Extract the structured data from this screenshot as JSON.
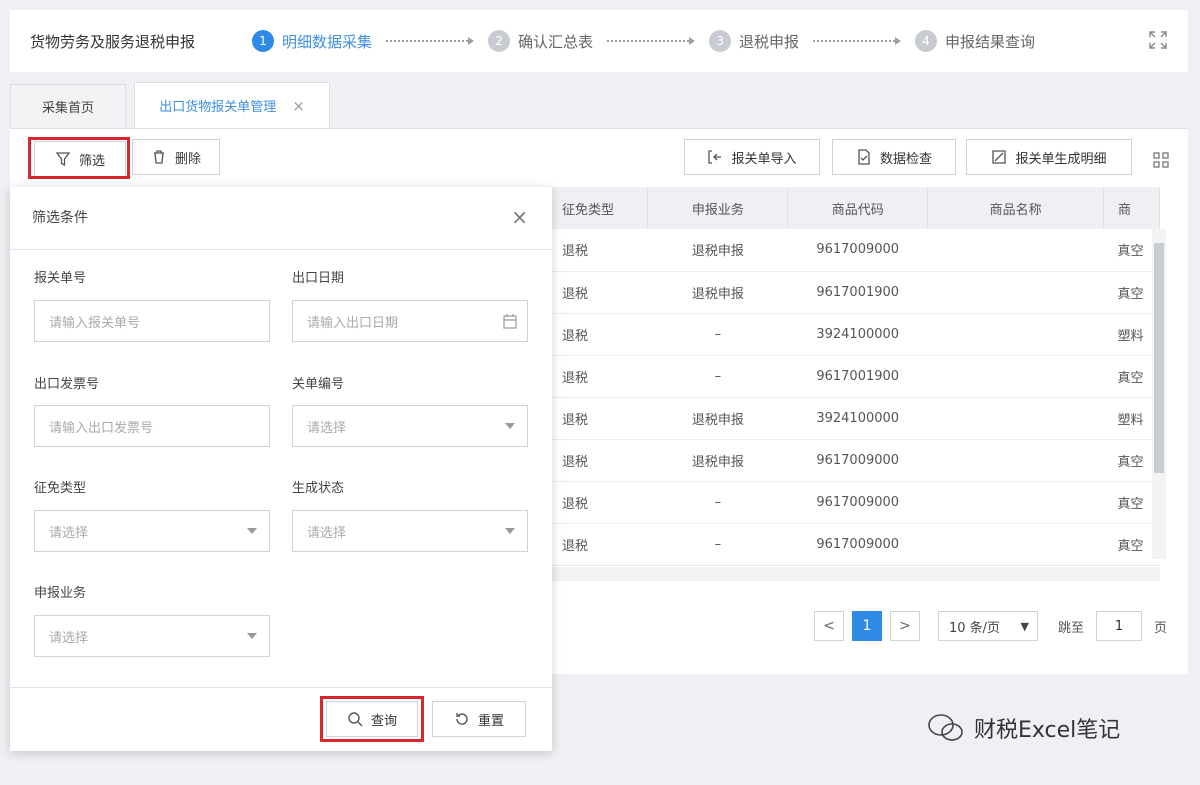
{
  "header": {
    "app_title": "货物劳务及服务退税申报",
    "steps": [
      {
        "num": "1",
        "label": "明细数据采集"
      },
      {
        "num": "2",
        "label": "确认汇总表"
      },
      {
        "num": "3",
        "label": "退税申报"
      },
      {
        "num": "4",
        "label": "申报结果查询"
      }
    ]
  },
  "tabs": [
    {
      "label": "采集首页"
    },
    {
      "label": "出口货物报关单管理",
      "close": "×"
    }
  ],
  "toolbar": {
    "filter_label": "筛选",
    "delete_label": "删除",
    "import_label": "报关单导入",
    "check_label": "数据检查",
    "generate_label": "报关单生成明细"
  },
  "table": {
    "headers": [
      "征免类型",
      "申报业务",
      "商品代码",
      "商品名称",
      "商"
    ],
    "rows": [
      [
        "退税",
        "退税申报",
        "9617009000",
        "",
        "真空"
      ],
      [
        "退税",
        "退税申报",
        "9617001900",
        "",
        "真空"
      ],
      [
        "退税",
        "–",
        "3924100000",
        "",
        "塑料"
      ],
      [
        "退税",
        "–",
        "9617001900",
        "",
        "真空"
      ],
      [
        "退税",
        "退税申报",
        "3924100000",
        "",
        "塑料"
      ],
      [
        "退税",
        "退税申报",
        "9617009000",
        "",
        "真空"
      ],
      [
        "退税",
        "–",
        "9617009000",
        "",
        "真空"
      ],
      [
        "退税",
        "–",
        "9617009000",
        "",
        "真空"
      ]
    ]
  },
  "pager": {
    "prev": "<",
    "current": "1",
    "next": ">",
    "page_size": "10 条/页",
    "jump_prefix": "跳至",
    "jump_value": "1",
    "jump_suffix": "页"
  },
  "filter": {
    "title": "筛选条件",
    "close": "×",
    "fields": {
      "declaration_no": {
        "label": "报关单号",
        "placeholder": "请输入报关单号"
      },
      "export_date": {
        "label": "出口日期",
        "placeholder": "请输入出口日期"
      },
      "invoice_no": {
        "label": "出口发票号",
        "placeholder": "请输入出口发票号"
      },
      "customs_code": {
        "label": "关单编号",
        "placeholder": "请选择"
      },
      "exemption_type": {
        "label": "征免类型",
        "placeholder": "请选择"
      },
      "generate_status": {
        "label": "生成状态",
        "placeholder": "请选择"
      },
      "declare_business": {
        "label": "申报业务",
        "placeholder": "请选择"
      }
    },
    "query_label": "查询",
    "reset_label": "重置"
  },
  "watermark": {
    "text": "财税Excel笔记"
  },
  "colors": {
    "accent": "#2f8ae6",
    "highlight": "#d9262c"
  }
}
